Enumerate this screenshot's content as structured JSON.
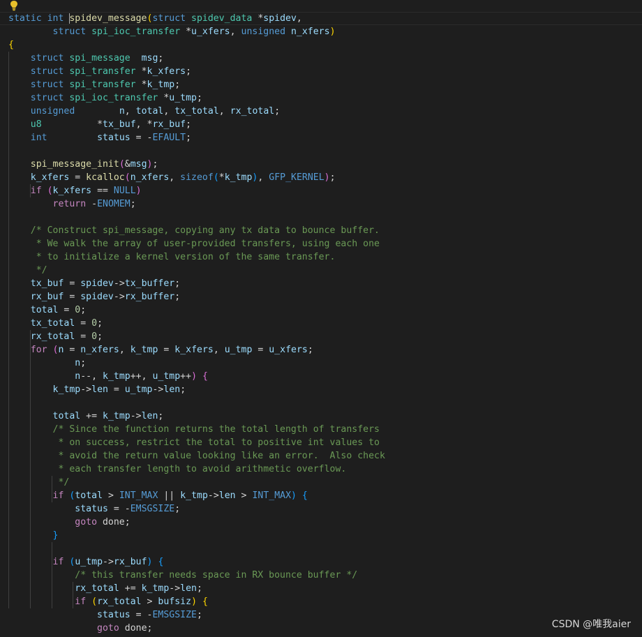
{
  "editor": {
    "language": "c",
    "lightbulb_icon": "lightbulb-icon",
    "watermark": "CSDN @唯我aier",
    "lines": [
      [
        [
          "kw",
          "static "
        ],
        [
          "kw",
          "int "
        ],
        [
          "cursor",
          ""
        ],
        [
          "fn",
          "spidev_message"
        ],
        [
          "b1",
          "("
        ],
        [
          "kw",
          "struct "
        ],
        [
          "type",
          "spidev_data "
        ],
        [
          "op",
          "*"
        ],
        [
          "var",
          "spidev"
        ],
        [
          "op",
          ","
        ]
      ],
      [
        [
          "op",
          "        "
        ],
        [
          "kw",
          "struct "
        ],
        [
          "type",
          "spi_ioc_transfer "
        ],
        [
          "op",
          "*"
        ],
        [
          "var",
          "u_xfers"
        ],
        [
          "op",
          ", "
        ],
        [
          "kw",
          "unsigned "
        ],
        [
          "var",
          "n_xfers"
        ],
        [
          "b1",
          ")"
        ]
      ],
      [
        [
          "b1",
          "{"
        ]
      ],
      [
        [
          "op",
          "    "
        ],
        [
          "kw",
          "struct "
        ],
        [
          "type",
          "spi_message "
        ],
        [
          "op",
          " "
        ],
        [
          "var",
          "msg"
        ],
        [
          "op",
          ";"
        ]
      ],
      [
        [
          "op",
          "    "
        ],
        [
          "kw",
          "struct "
        ],
        [
          "type",
          "spi_transfer "
        ],
        [
          "op",
          "*"
        ],
        [
          "var",
          "k_xfers"
        ],
        [
          "op",
          ";"
        ]
      ],
      [
        [
          "op",
          "    "
        ],
        [
          "kw",
          "struct "
        ],
        [
          "type",
          "spi_transfer "
        ],
        [
          "op",
          "*"
        ],
        [
          "var",
          "k_tmp"
        ],
        [
          "op",
          ";"
        ]
      ],
      [
        [
          "op",
          "    "
        ],
        [
          "kw",
          "struct "
        ],
        [
          "type",
          "spi_ioc_transfer "
        ],
        [
          "op",
          "*"
        ],
        [
          "var",
          "u_tmp"
        ],
        [
          "op",
          ";"
        ]
      ],
      [
        [
          "op",
          "    "
        ],
        [
          "kw",
          "unsigned"
        ],
        [
          "op",
          "        "
        ],
        [
          "var",
          "n"
        ],
        [
          "op",
          ", "
        ],
        [
          "var",
          "total"
        ],
        [
          "op",
          ", "
        ],
        [
          "var",
          "tx_total"
        ],
        [
          "op",
          ", "
        ],
        [
          "var",
          "rx_total"
        ],
        [
          "op",
          ";"
        ]
      ],
      [
        [
          "op",
          "    "
        ],
        [
          "type",
          "u8"
        ],
        [
          "op",
          "          "
        ],
        [
          "op",
          "*"
        ],
        [
          "var",
          "tx_buf"
        ],
        [
          "op",
          ", *"
        ],
        [
          "var",
          "rx_buf"
        ],
        [
          "op",
          ";"
        ]
      ],
      [
        [
          "op",
          "    "
        ],
        [
          "kw",
          "int"
        ],
        [
          "op",
          "         "
        ],
        [
          "var",
          "status"
        ],
        [
          "op",
          " = -"
        ],
        [
          "mac",
          "EFAULT"
        ],
        [
          "op",
          ";"
        ]
      ],
      [],
      [
        [
          "op",
          "    "
        ],
        [
          "fn",
          "spi_message_init"
        ],
        [
          "b2",
          "("
        ],
        [
          "op",
          "&"
        ],
        [
          "var",
          "msg"
        ],
        [
          "b2",
          ")"
        ],
        [
          "op",
          ";"
        ]
      ],
      [
        [
          "op",
          "    "
        ],
        [
          "var",
          "k_xfers"
        ],
        [
          "op",
          " = "
        ],
        [
          "fn",
          "kcalloc"
        ],
        [
          "b2",
          "("
        ],
        [
          "var",
          "n_xfers"
        ],
        [
          "op",
          ", "
        ],
        [
          "kw",
          "sizeof"
        ],
        [
          "b3",
          "("
        ],
        [
          "op",
          "*"
        ],
        [
          "var",
          "k_tmp"
        ],
        [
          "b3",
          ")"
        ],
        [
          "op",
          ", "
        ],
        [
          "mac",
          "GFP_KERNEL"
        ],
        [
          "b2",
          ")"
        ],
        [
          "op",
          ";"
        ]
      ],
      [
        [
          "op",
          "    "
        ],
        [
          "ctrl",
          "if "
        ],
        [
          "b2",
          "("
        ],
        [
          "var",
          "k_xfers"
        ],
        [
          "op",
          " == "
        ],
        [
          "mac",
          "NULL"
        ],
        [
          "b2",
          ")"
        ]
      ],
      [
        [
          "op",
          "        "
        ],
        [
          "ctrl",
          "return "
        ],
        [
          "op",
          "-"
        ],
        [
          "mac",
          "ENOMEM"
        ],
        [
          "op",
          ";"
        ]
      ],
      [],
      [
        [
          "op",
          "    "
        ],
        [
          "cm",
          "/* Construct spi_message, copying any tx data to bounce buffer."
        ]
      ],
      [
        [
          "op",
          "     "
        ],
        [
          "cm",
          "* We walk the array of user-provided transfers, using each one"
        ]
      ],
      [
        [
          "op",
          "     "
        ],
        [
          "cm",
          "* to initialize a kernel version of the same transfer."
        ]
      ],
      [
        [
          "op",
          "     "
        ],
        [
          "cm",
          "*/"
        ]
      ],
      [
        [
          "op",
          "    "
        ],
        [
          "var",
          "tx_buf"
        ],
        [
          "op",
          " = "
        ],
        [
          "var",
          "spidev"
        ],
        [
          "op",
          "->"
        ],
        [
          "var",
          "tx_buffer"
        ],
        [
          "op",
          ";"
        ]
      ],
      [
        [
          "op",
          "    "
        ],
        [
          "var",
          "rx_buf"
        ],
        [
          "op",
          " = "
        ],
        [
          "var",
          "spidev"
        ],
        [
          "op",
          "->"
        ],
        [
          "var",
          "rx_buffer"
        ],
        [
          "op",
          ";"
        ]
      ],
      [
        [
          "op",
          "    "
        ],
        [
          "var",
          "total"
        ],
        [
          "op",
          " = "
        ],
        [
          "num",
          "0"
        ],
        [
          "op",
          ";"
        ]
      ],
      [
        [
          "op",
          "    "
        ],
        [
          "var",
          "tx_total"
        ],
        [
          "op",
          " = "
        ],
        [
          "num",
          "0"
        ],
        [
          "op",
          ";"
        ]
      ],
      [
        [
          "op",
          "    "
        ],
        [
          "var",
          "rx_total"
        ],
        [
          "op",
          " = "
        ],
        [
          "num",
          "0"
        ],
        [
          "op",
          ";"
        ]
      ],
      [
        [
          "op",
          "    "
        ],
        [
          "ctrl",
          "for "
        ],
        [
          "b2",
          "("
        ],
        [
          "var",
          "n"
        ],
        [
          "op",
          " = "
        ],
        [
          "var",
          "n_xfers"
        ],
        [
          "op",
          ", "
        ],
        [
          "var",
          "k_tmp"
        ],
        [
          "op",
          " = "
        ],
        [
          "var",
          "k_xfers"
        ],
        [
          "op",
          ", "
        ],
        [
          "var",
          "u_tmp"
        ],
        [
          "op",
          " = "
        ],
        [
          "var",
          "u_xfers"
        ],
        [
          "op",
          ";"
        ]
      ],
      [
        [
          "op",
          "            "
        ],
        [
          "var",
          "n"
        ],
        [
          "op",
          ";"
        ]
      ],
      [
        [
          "op",
          "            "
        ],
        [
          "var",
          "n"
        ],
        [
          "op",
          "--, "
        ],
        [
          "var",
          "k_tmp"
        ],
        [
          "op",
          "++, "
        ],
        [
          "var",
          "u_tmp"
        ],
        [
          "op",
          "++"
        ],
        [
          "b2",
          ")"
        ],
        [
          "op",
          " "
        ],
        [
          "b2",
          "{"
        ]
      ],
      [
        [
          "op",
          "        "
        ],
        [
          "var",
          "k_tmp"
        ],
        [
          "op",
          "->"
        ],
        [
          "var",
          "len"
        ],
        [
          "op",
          " = "
        ],
        [
          "var",
          "u_tmp"
        ],
        [
          "op",
          "->"
        ],
        [
          "var",
          "len"
        ],
        [
          "op",
          ";"
        ]
      ],
      [],
      [
        [
          "op",
          "        "
        ],
        [
          "var",
          "total"
        ],
        [
          "op",
          " += "
        ],
        [
          "var",
          "k_tmp"
        ],
        [
          "op",
          "->"
        ],
        [
          "var",
          "len"
        ],
        [
          "op",
          ";"
        ]
      ],
      [
        [
          "op",
          "        "
        ],
        [
          "cm",
          "/* Since the function returns the total length of transfers"
        ]
      ],
      [
        [
          "op",
          "         "
        ],
        [
          "cm",
          "* on success, restrict the total to positive int values to"
        ]
      ],
      [
        [
          "op",
          "         "
        ],
        [
          "cm",
          "* avoid the return value looking like an error.  Also check"
        ]
      ],
      [
        [
          "op",
          "         "
        ],
        [
          "cm",
          "* each transfer length to avoid arithmetic overflow."
        ]
      ],
      [
        [
          "op",
          "         "
        ],
        [
          "cm",
          "*/"
        ]
      ],
      [
        [
          "op",
          "        "
        ],
        [
          "ctrl",
          "if "
        ],
        [
          "b3",
          "("
        ],
        [
          "var",
          "total"
        ],
        [
          "op",
          " > "
        ],
        [
          "mac",
          "INT_MAX"
        ],
        [
          "op",
          " || "
        ],
        [
          "var",
          "k_tmp"
        ],
        [
          "op",
          "->"
        ],
        [
          "var",
          "len"
        ],
        [
          "op",
          " > "
        ],
        [
          "mac",
          "INT_MAX"
        ],
        [
          "b3",
          ")"
        ],
        [
          "op",
          " "
        ],
        [
          "b3",
          "{"
        ]
      ],
      [
        [
          "op",
          "            "
        ],
        [
          "var",
          "status"
        ],
        [
          "op",
          " = -"
        ],
        [
          "mac",
          "EMSGSIZE"
        ],
        [
          "op",
          ";"
        ]
      ],
      [
        [
          "op",
          "            "
        ],
        [
          "ctrl",
          "goto "
        ],
        [
          "op",
          "done;"
        ]
      ],
      [
        [
          "op",
          "        "
        ],
        [
          "b3",
          "}"
        ]
      ],
      [],
      [
        [
          "op",
          "        "
        ],
        [
          "ctrl",
          "if "
        ],
        [
          "b3",
          "("
        ],
        [
          "var",
          "u_tmp"
        ],
        [
          "op",
          "->"
        ],
        [
          "var",
          "rx_buf"
        ],
        [
          "b3",
          ")"
        ],
        [
          "op",
          " "
        ],
        [
          "b3",
          "{"
        ]
      ],
      [
        [
          "op",
          "            "
        ],
        [
          "cm",
          "/* this transfer needs space in RX bounce buffer */"
        ]
      ],
      [
        [
          "op",
          "            "
        ],
        [
          "var",
          "rx_total"
        ],
        [
          "op",
          " += "
        ],
        [
          "var",
          "k_tmp"
        ],
        [
          "op",
          "->"
        ],
        [
          "var",
          "len"
        ],
        [
          "op",
          ";"
        ]
      ],
      [
        [
          "op",
          "            "
        ],
        [
          "ctrl",
          "if "
        ],
        [
          "b1",
          "("
        ],
        [
          "var",
          "rx_total"
        ],
        [
          "op",
          " > "
        ],
        [
          "var",
          "bufsiz"
        ],
        [
          "b1",
          ")"
        ],
        [
          "op",
          " "
        ],
        [
          "b1",
          "{"
        ]
      ],
      [
        [
          "op",
          "                "
        ],
        [
          "var",
          "status"
        ],
        [
          "op",
          " = -"
        ],
        [
          "mac",
          "EMSGSIZE"
        ],
        [
          "op",
          ";"
        ]
      ],
      [
        [
          "op",
          "                "
        ],
        [
          "ctrl",
          "goto "
        ],
        [
          "op",
          "done;"
        ]
      ]
    ],
    "guides": [
      [],
      [],
      [],
      [
        1
      ],
      [
        1
      ],
      [
        1
      ],
      [
        1
      ],
      [
        1
      ],
      [
        1
      ],
      [
        1
      ],
      [
        1
      ],
      [
        1
      ],
      [
        1
      ],
      [
        1,
        2
      ],
      [
        1
      ],
      [
        1
      ],
      [
        1
      ],
      [
        1
      ],
      [
        1
      ],
      [
        1
      ],
      [
        1
      ],
      [
        1
      ],
      [
        1
      ],
      [
        1
      ],
      [
        1,
        2
      ],
      [
        1,
        2
      ],
      [
        1,
        2
      ],
      [
        1,
        2
      ],
      [
        1,
        2
      ],
      [
        1,
        2
      ],
      [
        1,
        2
      ],
      [
        1,
        2
      ],
      [
        1,
        2
      ],
      [
        1,
        2
      ],
      [
        1,
        2
      ],
      [
        1,
        2,
        3
      ],
      [
        1,
        2,
        3
      ],
      [
        1,
        2
      ],
      [
        1,
        2
      ],
      [
        1,
        2
      ],
      [
        1,
        2,
        3
      ],
      [
        1,
        2,
        3
      ],
      [
        1,
        2,
        3
      ],
      [
        1,
        2,
        3,
        4
      ],
      [
        1,
        2,
        3,
        4
      ]
    ]
  }
}
